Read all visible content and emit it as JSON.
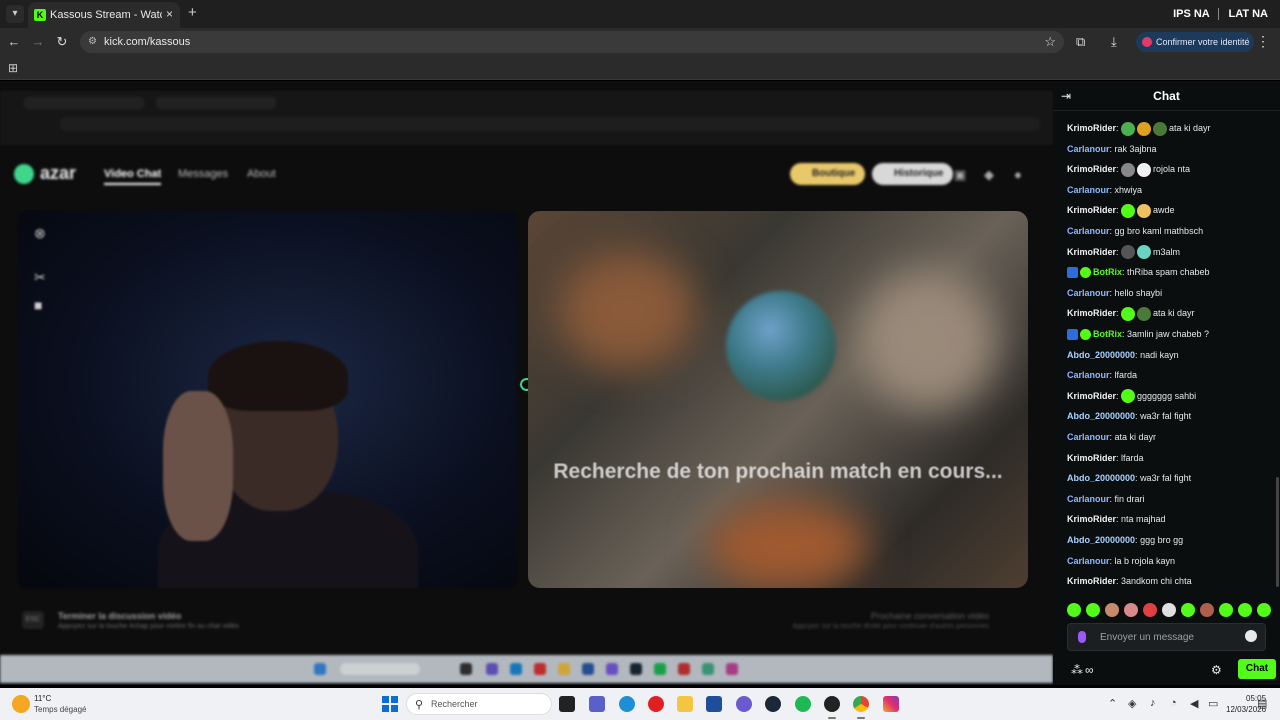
{
  "browser": {
    "tab_title": "Kassous Stream - Watch Live o",
    "tab_favicon": "K",
    "new_tab": "+",
    "close_tab": "×",
    "profile_a": "IPS",
    "profile_b": "NA",
    "profile_c": "LAT",
    "profile_d": "NA",
    "url": "kick.com/kassous",
    "confirm_identity": "Confirmer votre identité"
  },
  "stream": {
    "azar": {
      "logo": "azar",
      "nav": [
        "Video Chat",
        "Messages",
        "About"
      ],
      "boutique": "Boutique",
      "historique": "Historique"
    },
    "searching_text": "Recherche de ton prochain match en cours...",
    "bottom": {
      "esc": "ESC",
      "end_title": "Terminer la discussion vidéo",
      "end_sub": "Appuyez sur la touche échap pour mettre fin au chat vidéo",
      "next_title": "Prochaine conversation vidéo",
      "next_sub": "Appuyez sur la touche droite pour continuer d'autres personnes"
    }
  },
  "chat": {
    "title": "Chat",
    "colors": {
      "krimo": "#f2f2f2",
      "carlanour": "#8fb8ff",
      "abdo": "#a9d2ff",
      "botrix": "#53fc18"
    },
    "messages": [
      {
        "user": "KrimoRider",
        "text": "ata ki dayr",
        "emotes": [
          "#4caf50",
          "#e0a020",
          "#4a7a3a"
        ]
      },
      {
        "user": "Carlanour",
        "text": "rak 3ajbna"
      },
      {
        "user": "KrimoRider",
        "text": "rojola nta",
        "emotes": [
          "#888888",
          "#f0f0f0"
        ]
      },
      {
        "user": "Carlanour",
        "text": "xhwiya"
      },
      {
        "user": "KrimoRider",
        "text": "awde",
        "emotes": [
          "#53fc18",
          "#f0c060"
        ]
      },
      {
        "user": "Carlanour",
        "text": "gg bro kaml mathbsch"
      },
      {
        "user": "KrimoRider",
        "text": "m3alm",
        "emotes": [
          "#555555",
          "#6ad4c0"
        ]
      },
      {
        "user": "BotRix",
        "text": "thRiba spam chabeb",
        "bot": true
      },
      {
        "user": "Carlanour",
        "text": "hello shaybi"
      },
      {
        "user": "KrimoRider",
        "text": "ata ki dayr",
        "emotes": [
          "#53fc18",
          "#4a7a3a"
        ]
      },
      {
        "user": "BotRix",
        "text": "3amlin jaw chabeb ?",
        "bot": true
      },
      {
        "user": "Abdo_20000000",
        "text": "nadi kayn"
      },
      {
        "user": "Carlanour",
        "text": "lfarda"
      },
      {
        "user": "KrimoRider",
        "text": "ggggggg sahbi",
        "emotes": [
          "#53fc18"
        ]
      },
      {
        "user": "Abdo_20000000",
        "text": "wa3r fal fight"
      },
      {
        "user": "Carlanour",
        "text": "ata ki dayr"
      },
      {
        "user": "KrimoRider",
        "text": "lfarda"
      },
      {
        "user": "Abdo_20000000",
        "text": "wa3r fal fight"
      },
      {
        "user": "Carlanour",
        "text": "fin drari"
      },
      {
        "user": "KrimoRider",
        "text": "nta majhad"
      },
      {
        "user": "Abdo_20000000",
        "text": "ggg bro gg"
      },
      {
        "user": "Carlanour",
        "text": "la b rojola kayn"
      },
      {
        "user": "KrimoRider",
        "text": "3andkom chi chta"
      }
    ],
    "emote_bar": [
      "#53fc18",
      "#53fc18",
      "#c98a6a",
      "#d88a8a",
      "#e04040",
      "#e0e0e0",
      "#53fc18",
      "#b0604a",
      "#53fc18",
      "#53fc18",
      "#53fc18"
    ],
    "input_placeholder": "Envoyer un message",
    "send_label": "Chat",
    "footer_glyph": "∞"
  },
  "taskbar": {
    "temperature": "11°C",
    "weather": "Temps dégagé",
    "search_placeholder": "Rechercher",
    "time": "05:05",
    "date": "12/03/2026"
  }
}
